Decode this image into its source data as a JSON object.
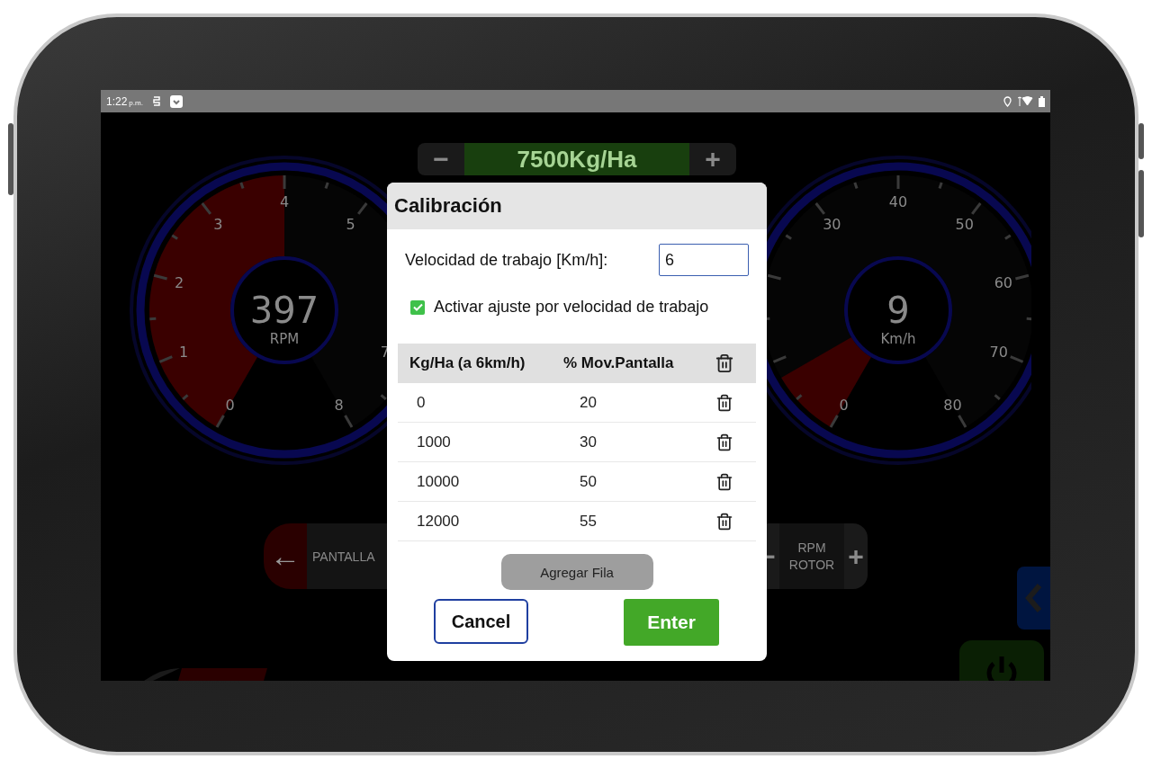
{
  "status_bar": {
    "time": "1:22",
    "period": "p.m."
  },
  "dashboard": {
    "rate_control": {
      "minus": "−",
      "value": "7500Kg/Ha",
      "plus": "+"
    },
    "gauges": [
      {
        "value": "397",
        "unit": "RPM",
        "labels": [
          "0",
          "1",
          "2",
          "3",
          "4",
          "5",
          "7",
          "8"
        ],
        "level": 0.5
      },
      {
        "value": "9",
        "unit": "Km/h",
        "labels": [
          "0",
          "30",
          "40",
          "50",
          "60",
          "70",
          "80"
        ],
        "level": 0.1
      }
    ],
    "screen_control": {
      "arrow": "←",
      "label": "PANTALLA"
    },
    "rotor_control": {
      "minus": "−",
      "label": "RPM ROTOR",
      "plus": "+"
    }
  },
  "dialog": {
    "title": "Calibración",
    "speed_label": "Velocidad de trabajo [Km/h]:",
    "speed_value": "6",
    "adjust": {
      "label": "Activar ajuste por velocidad de trabajo",
      "checked": true
    },
    "table": {
      "columns": [
        "Kg/Ha (a 6km/h)",
        "% Mov.Pantalla"
      ],
      "rows": [
        [
          "0",
          "20"
        ],
        [
          "1000",
          "30"
        ],
        [
          "10000",
          "50"
        ],
        [
          "12000",
          "55"
        ]
      ]
    },
    "add_row": "Agregar Fila",
    "cancel": "Cancel",
    "enter": "Enter"
  }
}
